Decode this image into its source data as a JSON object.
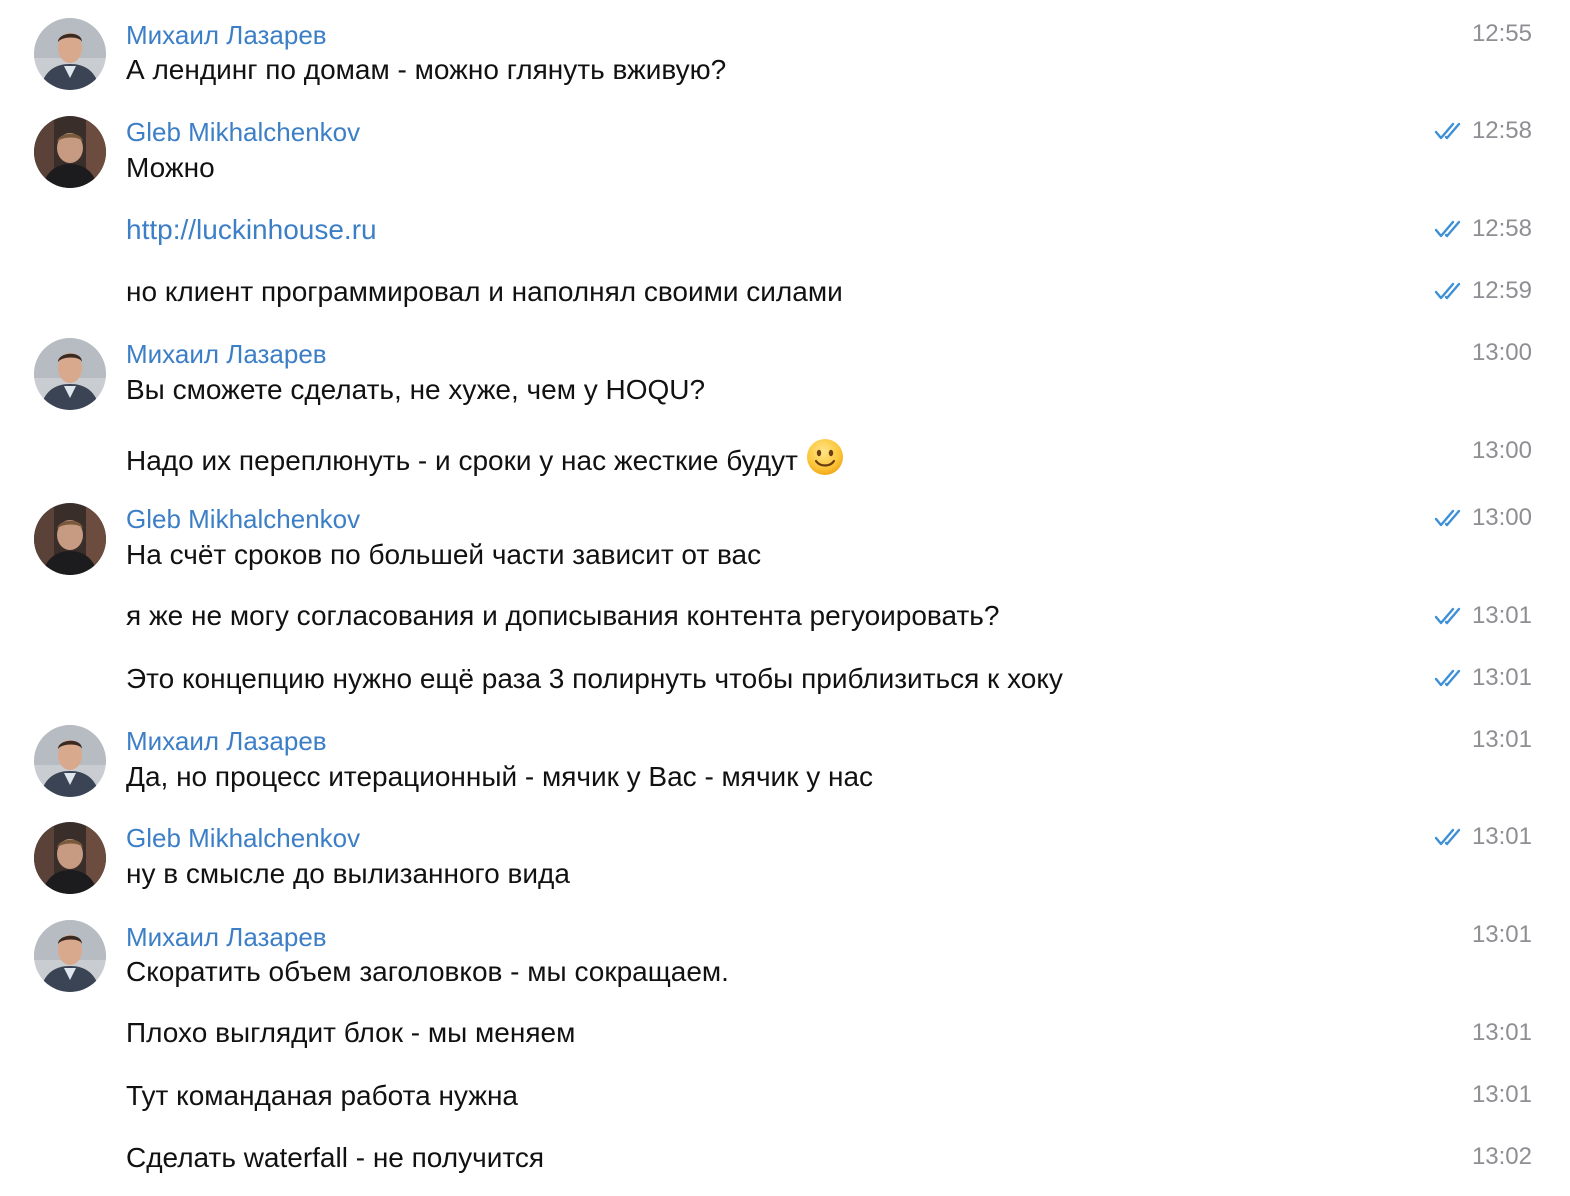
{
  "messages": [
    {
      "avatar": "mikhail-avatar",
      "sender": "Михаил Лазарев",
      "text": "А лендинг по домам - можно глянуть вживую?",
      "time": "12:55",
      "read": false
    },
    {
      "avatar": "gleb-avatar",
      "sender": "Gleb Mikhalchenkov",
      "text": "Можно",
      "time": "12:58",
      "read": true
    },
    {
      "text": "http://luckinhouse.ru",
      "time": "12:58",
      "read": true,
      "link": true
    },
    {
      "text": "но клиент программировал и наполнял своими силами",
      "time": "12:59",
      "read": true
    },
    {
      "avatar": "mikhail-avatar",
      "sender": "Михаил Лазарев",
      "text": "Вы сможете сделать, не хуже, чем у HOQU?",
      "time": "13:00",
      "read": false
    },
    {
      "text": "Надо их переплюнуть - и сроки у нас жесткие будут",
      "emoji": "slightly-smiling-face",
      "time": "13:00",
      "read": false
    },
    {
      "avatar": "gleb-avatar",
      "sender": "Gleb Mikhalchenkov",
      "text": "На счёт сроков по большей части зависит от вас",
      "time": "13:00",
      "read": true
    },
    {
      "text": "я же не могу согласования и дописывания контента регуоировать?",
      "time": "13:01",
      "read": true
    },
    {
      "text": "Это концепцию нужно ещё раза 3 полирнуть чтобы приблизиться к хоку",
      "time": "13:01",
      "read": true
    },
    {
      "avatar": "mikhail-avatar",
      "sender": "Михаил Лазарев",
      "text": "Да, но процесс итерационный - мячик у Вас - мячик у нас",
      "time": "13:01",
      "read": false
    },
    {
      "avatar": "gleb-avatar",
      "sender": "Gleb Mikhalchenkov",
      "text": "ну в смысле до вылизанного вида",
      "time": "13:01",
      "read": true
    },
    {
      "avatar": "mikhail-avatar",
      "sender": "Михаил Лазарев",
      "text": "Скоратить объем заголовков - мы сокращаем.",
      "time": "13:01",
      "read": false
    },
    {
      "text": "Плохо выглядит блок - мы меняем",
      "time": "13:01",
      "read": false
    },
    {
      "text": "Тут команданая работа нужна",
      "time": "13:01",
      "read": false
    },
    {
      "text": "Сделать waterfall - не получится",
      "time": "13:02",
      "read": false
    }
  ],
  "colors": {
    "sender": "#3d7fc6",
    "link": "#3d7fc6",
    "time": "#8e8e93",
    "check": "#3d8fd6",
    "text": "#111111"
  }
}
